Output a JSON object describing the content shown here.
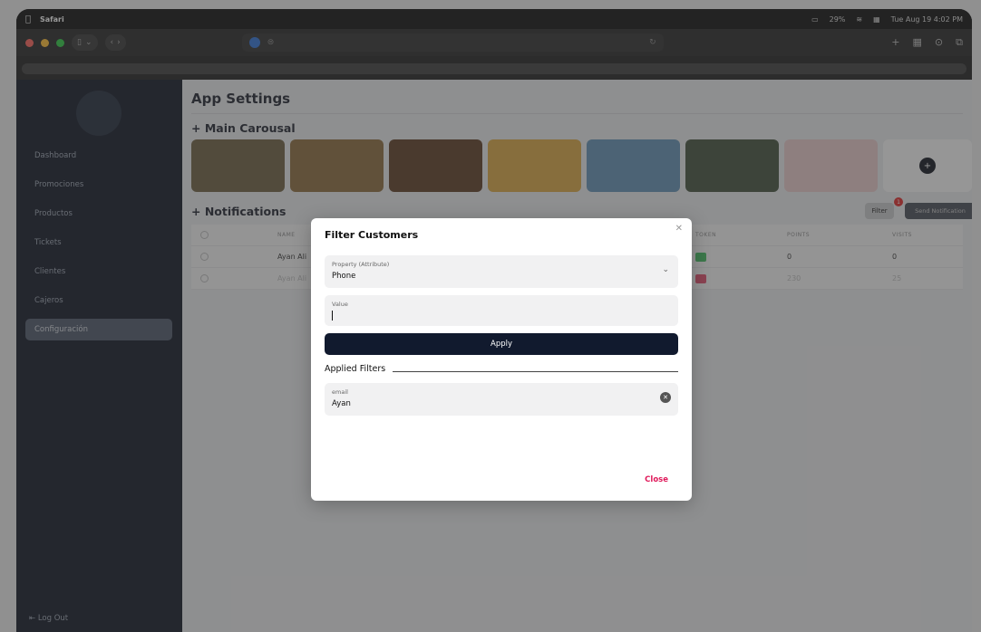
{
  "menubar": {
    "app": "Safari",
    "battery": "29%",
    "datetime": "Tue Aug 19  4:02 PM"
  },
  "sidebar": {
    "items": [
      {
        "label": "Dashboard"
      },
      {
        "label": "Promociones"
      },
      {
        "label": "Productos"
      },
      {
        "label": "Tickets"
      },
      {
        "label": "Clientes"
      },
      {
        "label": "Cajeros"
      },
      {
        "label": "Configuración",
        "active": true
      }
    ],
    "logout": "Log Out"
  },
  "main": {
    "title": "App Settings",
    "carousel_heading": "+ Main Carousal",
    "carousel_colors": [
      "#6b5d3e",
      "#8a6a3a",
      "#5a3a20",
      "#d9a640",
      "#5f8fb3",
      "#3f4f3a",
      "#e9c9c9"
    ],
    "notifications_heading": "+ Notifications",
    "filter_label": "Filter",
    "filter_count": "1",
    "send_label": "Send Notification",
    "table": {
      "headers": [
        "NAME",
        "TOKEN",
        "POINTS",
        "VISITS"
      ],
      "rows": [
        {
          "name": "Ayan Ali",
          "points": "0",
          "visits": "0",
          "token_color": "#3dbb5c"
        },
        {
          "name": "Ayan Ali",
          "points": "230",
          "visits": "25",
          "token_color": "#e04a6a"
        }
      ]
    }
  },
  "modal": {
    "title": "Filter Customers",
    "property_label": "Property (Attribute)",
    "property_value": "Phone",
    "value_label": "Value",
    "apply": "Apply",
    "applied_heading": "Applied Filters",
    "applied": [
      {
        "label": "email",
        "value": "Ayan"
      }
    ],
    "close": "Close"
  }
}
